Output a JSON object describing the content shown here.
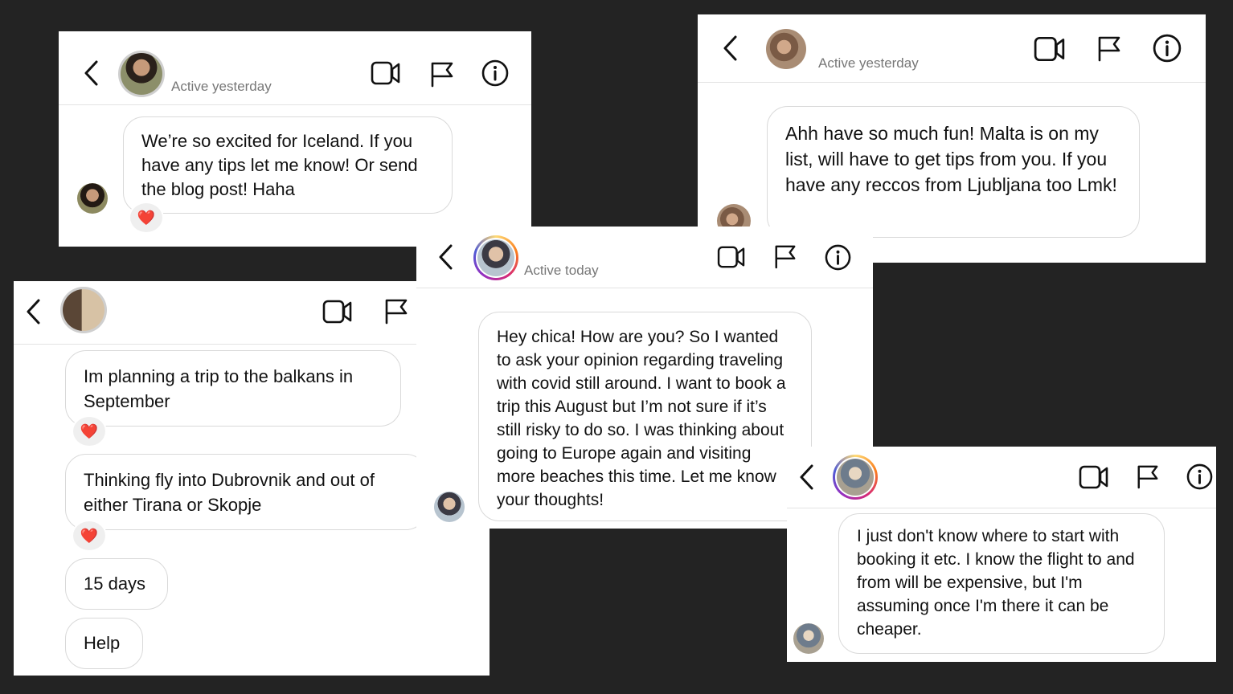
{
  "colors": {
    "background": "#232323",
    "reaction": "#e0245e"
  },
  "chat_a": {
    "status": "Active yesterday",
    "message": "We’re so excited for Iceland. If you have any tips let me know! Or send the blog post! Haha",
    "reaction": "❤️"
  },
  "chat_b": {
    "status": "Active yesterday",
    "message": "Ahh have so much fun! Malta is on my list, will have to get tips from you. If you have any reccos from Ljubljana too Lmk!"
  },
  "chat_c": {
    "messages": [
      {
        "text": "Im planning a trip to the balkans in September",
        "reaction": "❤️"
      },
      {
        "text": "Thinking fly into Dubrovnik and out of either Tirana or Skopje",
        "reaction": "❤️"
      },
      {
        "text": "15 days"
      },
      {
        "text": "Help"
      }
    ]
  },
  "chat_d": {
    "status": "Active today",
    "message": "Hey chica! How are you? So I wanted to ask your opinion regarding traveling with covid still around. I want to book a trip this August but I’m not sure if it’s still risky to do so. I was thinking about going to Europe again and visiting more beaches this time. Let me know your thoughts!"
  },
  "chat_e": {
    "message": "I just don't know where to start with booking it etc. I know the flight to and from will be expensive,  but I'm assuming once I'm there it can be cheaper."
  },
  "icons": [
    "back-chevron-icon",
    "video-call-icon",
    "report-flag-icon",
    "info-icon",
    "heart-icon"
  ]
}
